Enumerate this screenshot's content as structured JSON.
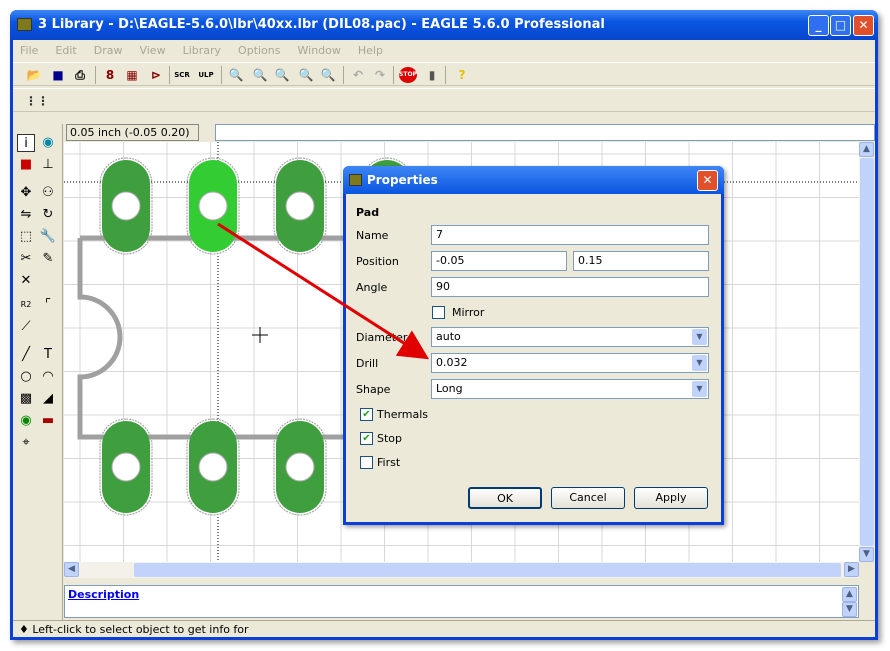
{
  "window": {
    "title": "3 Library - D:\\EAGLE-5.6.0\\lbr\\40xx.lbr (DIL08.pac) - EAGLE 5.6.0 Professional"
  },
  "menu": [
    "File",
    "Edit",
    "Draw",
    "View",
    "Library",
    "Options",
    "Window",
    "Help"
  ],
  "toolbar": {
    "scr_label": "SCR",
    "ulp_label": "ULP",
    "stop_label": "STOP",
    "help_label": "?"
  },
  "coord_display": "0.05 inch (-0.05 0.20)",
  "command_input": "",
  "description": {
    "link": "Description"
  },
  "status": "Left-click to select object to get info for",
  "dialog": {
    "title": "Properties",
    "section": "Pad",
    "name_label": "Name",
    "name_value": "7",
    "position_label": "Position",
    "pos_x": "-0.05",
    "pos_y": "0.15",
    "angle_label": "Angle",
    "angle_value": "90",
    "mirror_label": "Mirror",
    "mirror_checked": false,
    "diameter_label": "Diameter",
    "diameter_value": "auto",
    "drill_label": "Drill",
    "drill_value": "0.032",
    "shape_label": "Shape",
    "shape_value": "Long",
    "thermals_label": "Thermals",
    "thermals_checked": true,
    "stop_label": "Stop",
    "stop_checked": true,
    "first_label": "First",
    "first_checked": false,
    "ok": "OK",
    "cancel": "Cancel",
    "apply": "Apply"
  },
  "colors": {
    "pad": "#3f9f3f",
    "pad_selected": "#33cc33",
    "outline": "#a0a0a0",
    "arrow": "#e00000",
    "titlebar": "#0a55e0"
  }
}
